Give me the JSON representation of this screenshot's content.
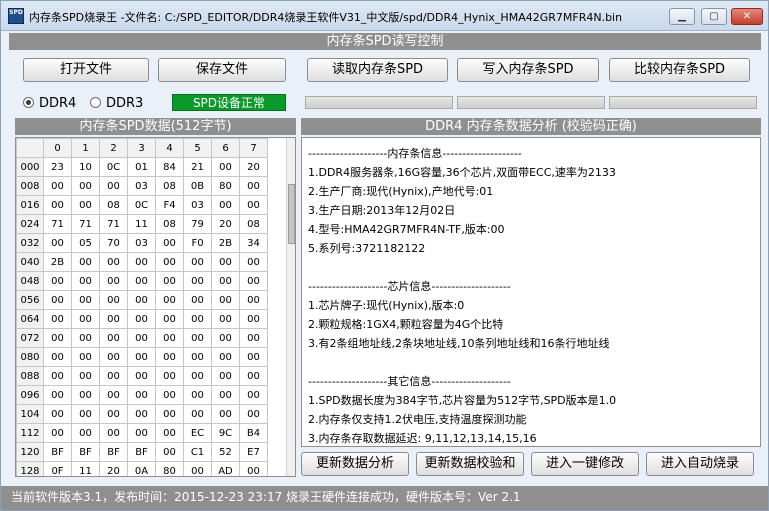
{
  "window": {
    "title": "内存条SPD烧录王 -文件名: C:/SPD_EDITOR/DDR4烧录王软件V31_中文版/spd/DDR4_Hynix_HMA42GR7MFR4N.bin",
    "icon_text": "SPD",
    "min_glyph": "▁",
    "max_glyph": "▢",
    "close_glyph": "✕"
  },
  "top_section_title": "内存条SPD读写控制",
  "buttons": {
    "open": "打开文件",
    "save": "保存文件",
    "read": "读取内存条SPD",
    "write": "写入内存条SPD",
    "compare": "比较内存条SPD",
    "refresh_analysis": "更新数据分析",
    "refresh_checksum": "更新数据校验和",
    "one_click_edit": "进入一键修改",
    "auto_burn": "进入自动烧录"
  },
  "mode": {
    "ddr4": "DDR4",
    "ddr3": "DDR3",
    "selected": "DDR4"
  },
  "device_status": "SPD设备正常",
  "left_title": "内存条SPD数据(512字节)",
  "right_title": "DDR4 内存条数据分析 (校验码正确)",
  "hex": {
    "columns": [
      "0",
      "1",
      "2",
      "3",
      "4",
      "5",
      "6",
      "7"
    ],
    "rows": [
      {
        "addr": "000",
        "cells": [
          "23",
          "10",
          "0C",
          "01",
          "84",
          "21",
          "00",
          "20"
        ]
      },
      {
        "addr": "008",
        "cells": [
          "00",
          "00",
          "00",
          "03",
          "08",
          "0B",
          "80",
          "00"
        ]
      },
      {
        "addr": "016",
        "cells": [
          "00",
          "00",
          "08",
          "0C",
          "F4",
          "03",
          "00",
          "00"
        ]
      },
      {
        "addr": "024",
        "cells": [
          "71",
          "71",
          "71",
          "11",
          "08",
          "79",
          "20",
          "08"
        ]
      },
      {
        "addr": "032",
        "cells": [
          "00",
          "05",
          "70",
          "03",
          "00",
          "F0",
          "2B",
          "34"
        ]
      },
      {
        "addr": "040",
        "cells": [
          "2B",
          "00",
          "00",
          "00",
          "00",
          "00",
          "00",
          "00"
        ]
      },
      {
        "addr": "048",
        "cells": [
          "00",
          "00",
          "00",
          "00",
          "00",
          "00",
          "00",
          "00"
        ]
      },
      {
        "addr": "056",
        "cells": [
          "00",
          "00",
          "00",
          "00",
          "00",
          "00",
          "00",
          "00"
        ]
      },
      {
        "addr": "064",
        "cells": [
          "00",
          "00",
          "00",
          "00",
          "00",
          "00",
          "00",
          "00"
        ]
      },
      {
        "addr": "072",
        "cells": [
          "00",
          "00",
          "00",
          "00",
          "00",
          "00",
          "00",
          "00"
        ]
      },
      {
        "addr": "080",
        "cells": [
          "00",
          "00",
          "00",
          "00",
          "00",
          "00",
          "00",
          "00"
        ]
      },
      {
        "addr": "088",
        "cells": [
          "00",
          "00",
          "00",
          "00",
          "00",
          "00",
          "00",
          "00"
        ]
      },
      {
        "addr": "096",
        "cells": [
          "00",
          "00",
          "00",
          "00",
          "00",
          "00",
          "00",
          "00"
        ]
      },
      {
        "addr": "104",
        "cells": [
          "00",
          "00",
          "00",
          "00",
          "00",
          "00",
          "00",
          "00"
        ]
      },
      {
        "addr": "112",
        "cells": [
          "00",
          "00",
          "00",
          "00",
          "00",
          "EC",
          "9C",
          "B4"
        ]
      },
      {
        "addr": "120",
        "cells": [
          "BF",
          "BF",
          "BF",
          "BF",
          "00",
          "C1",
          "52",
          "E7"
        ]
      },
      {
        "addr": "128",
        "cells": [
          "0F",
          "11",
          "20",
          "0A",
          "80",
          "00",
          "AD",
          "00"
        ]
      }
    ]
  },
  "analysis_lines": [
    "--------------------内存条信息--------------------",
    "1.DDR4服务器条,16G容量,36个芯片,双面带ECC,速率为2133",
    "2.生产厂商:现代(Hynix),产地代号:01",
    "3.生产日期:2013年12月02日",
    "4.型号:HMA42GR7MFR4N-TF,版本:00",
    "5.系列号:3721182122",
    "",
    "--------------------芯片信息--------------------",
    "1.芯片牌子:现代(Hynix),版本:0",
    "2.颗粒规格:1GX4,颗粒容量为4G个比特",
    "3.有2条组地址线,2条块地址线,10条列地址线和16条行地址线",
    "",
    "--------------------其它信息--------------------",
    "1.SPD数据长度为384字节,芯片容量为512字节,SPD版本是1.0",
    "2.内存条仅支持1.2伏电压,支持温度探测功能",
    "3.内存条存取数据延迟: 9,11,12,13,14,15,16"
  ],
  "statusbar": "当前软件版本3.1，发布时间：2015-12-23 23:17  烧录王硬件连接成功，硬件版本号：Ver 2.1",
  "colors": {
    "status_green": "#0a9a2a",
    "section_gray": "#8f8f8f",
    "close_red": "#c6402a"
  }
}
